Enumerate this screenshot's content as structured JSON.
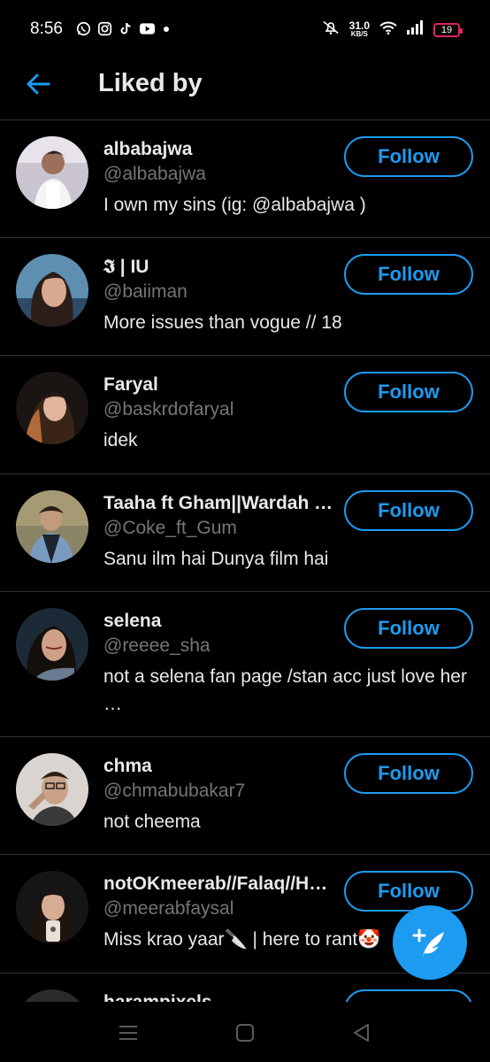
{
  "status_bar": {
    "time": "8:56",
    "app_icons": [
      "whatsapp-icon",
      "instagram-icon",
      "tiktok-icon",
      "youtube-icon"
    ],
    "network_speed_value": "31.0",
    "network_speed_unit": "KB/S",
    "battery_level": "19",
    "battery_color": "#e0245e"
  },
  "header": {
    "title": "Liked by",
    "back_icon": "arrow-left-icon"
  },
  "colors": {
    "accent": "#1d9bf0",
    "background": "#000000",
    "secondary_text": "#71767b",
    "divider": "#2f3336"
  },
  "users": [
    {
      "name": "albabajwa",
      "handle": "@albabajwa",
      "bio": "I own my sins (ig: @albabajwa )",
      "follow_label": "Follow"
    },
    {
      "name": "𝕴 | IU",
      "handle": "@baiiman",
      "bio": "More issues than vogue // 18",
      "follow_label": "Follow"
    },
    {
      "name": "Faryal",
      "handle": "@baskrdofaryal",
      "bio": "idek",
      "follow_label": "Follow"
    },
    {
      "name": "Taaha ft Gham||Wardah ⁷…",
      "handle": "@Coke_ft_Gum",
      "bio": "Sanu ilm hai Dunya film hai",
      "follow_label": "Follow"
    },
    {
      "name": "selena",
      "handle": "@reeee_sha",
      "bio": "not a selena fan page /stan acc just love her …",
      "follow_label": "Follow"
    },
    {
      "name": "chma",
      "handle": "@chmabubakar7",
      "bio": "not cheema",
      "follow_label": "Follow"
    },
    {
      "name": "notOKmeerab//Falaq//H…",
      "handle": "@meerabfaysal",
      "bio": "Miss krao yaar🔪 | here to rant🤡",
      "follow_label": "Follow"
    },
    {
      "name": "harampixels",
      "handle": "",
      "bio": "",
      "follow_label": "Follow"
    }
  ],
  "fab": {
    "icon": "compose-tweet-icon"
  },
  "nav_bar": {
    "icons": [
      "recents-menu-icon",
      "home-square-icon",
      "back-triangle-icon"
    ]
  }
}
